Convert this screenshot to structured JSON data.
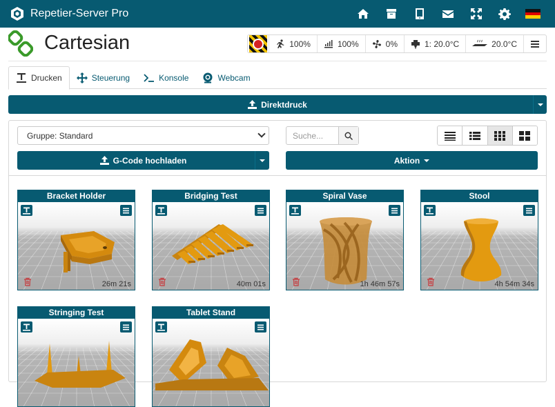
{
  "app": {
    "title": "Repetier-Server Pro"
  },
  "topnav": {
    "icons": [
      "home-icon",
      "archive-icon",
      "tablet-icon",
      "envelope-icon",
      "expand-icon",
      "gear-icon",
      "german-flag-icon"
    ]
  },
  "printer": {
    "name": "Cartesian"
  },
  "status": {
    "speed": "100%",
    "flow": "100%",
    "fan": "0%",
    "extruder": "1: 20.0°C",
    "bed": "20.0°C"
  },
  "tabs": [
    {
      "label": "Drucken",
      "icon": "print-icon",
      "active": true
    },
    {
      "label": "Steuerung",
      "icon": "move-arrows-icon",
      "active": false
    },
    {
      "label": "Konsole",
      "icon": "terminal-icon",
      "active": false
    },
    {
      "label": "Webcam",
      "icon": "webcam-icon",
      "active": false
    }
  ],
  "direct_print": {
    "label": "Direktdruck"
  },
  "toolbar": {
    "group_value": "Gruppe: Standard",
    "search_placeholder": "Suche...",
    "upload_label": "G-Code hochladen",
    "action_label": "Aktion",
    "view_modes": [
      "list-view",
      "detail-list-view",
      "small-grid-view",
      "large-grid-view"
    ],
    "active_view": "small-grid-view"
  },
  "models": [
    {
      "name": "Bracket Holder",
      "time": "26m 21s"
    },
    {
      "name": "Bridging Test",
      "time": "40m 01s"
    },
    {
      "name": "Spiral Vase",
      "time": "1h 46m 57s"
    },
    {
      "name": "Stool",
      "time": "4h 54m 34s"
    },
    {
      "name": "Stringing Test",
      "time": ""
    },
    {
      "name": "Tablet Stand",
      "time": ""
    }
  ],
  "colors": {
    "primary": "#075a71",
    "model": "#e39a10",
    "trash": "#c2494b"
  }
}
